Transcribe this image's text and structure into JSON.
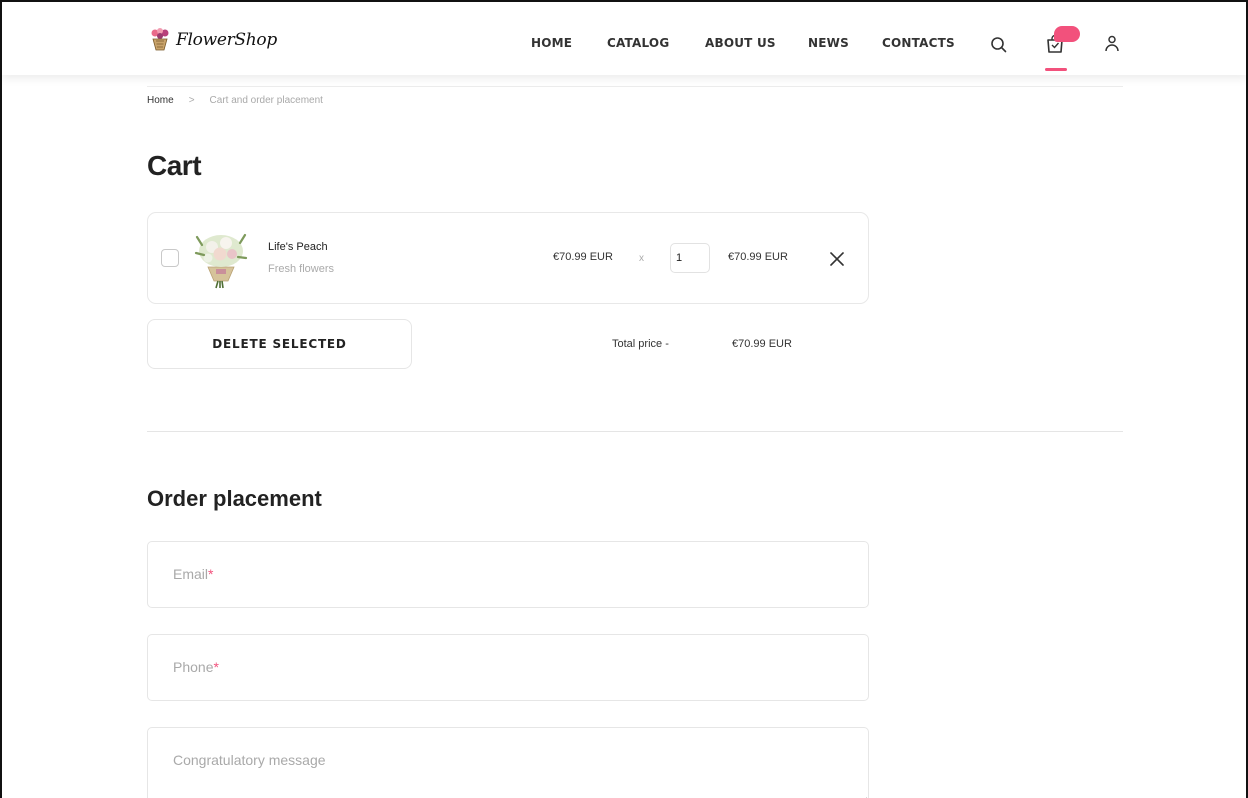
{
  "brand": {
    "name": "FlowerShop"
  },
  "nav": {
    "items": [
      "HOME",
      "CATALOG",
      "ABOUT US",
      "NEWS",
      "CONTACTS"
    ]
  },
  "header_icons": [
    "search-icon",
    "cart-icon",
    "user-icon"
  ],
  "breadcrumb": {
    "home": "Home",
    "separator": ">",
    "current": "Cart and order placement"
  },
  "cart": {
    "title": "Cart",
    "items": [
      {
        "name": "Life's Peach",
        "category": "Fresh flowers",
        "price": "€70.99 EUR",
        "multiplier": "x",
        "quantity": "1",
        "line_total": "€70.99 EUR",
        "checked": false
      }
    ],
    "delete_selected_label": "DELETE SELECTED",
    "total_label": "Total price -",
    "total_value": "€70.99 EUR"
  },
  "order": {
    "title": "Order placement",
    "fields": [
      {
        "label": "Email",
        "required": "*"
      },
      {
        "label": "Phone",
        "required": "*"
      },
      {
        "label": "Congratulatory message",
        "required": ""
      }
    ]
  },
  "colors": {
    "accent": "#f2517c",
    "text": "#2b2b2b",
    "muted": "#a9a9a9",
    "border": "#e6e6e6"
  }
}
